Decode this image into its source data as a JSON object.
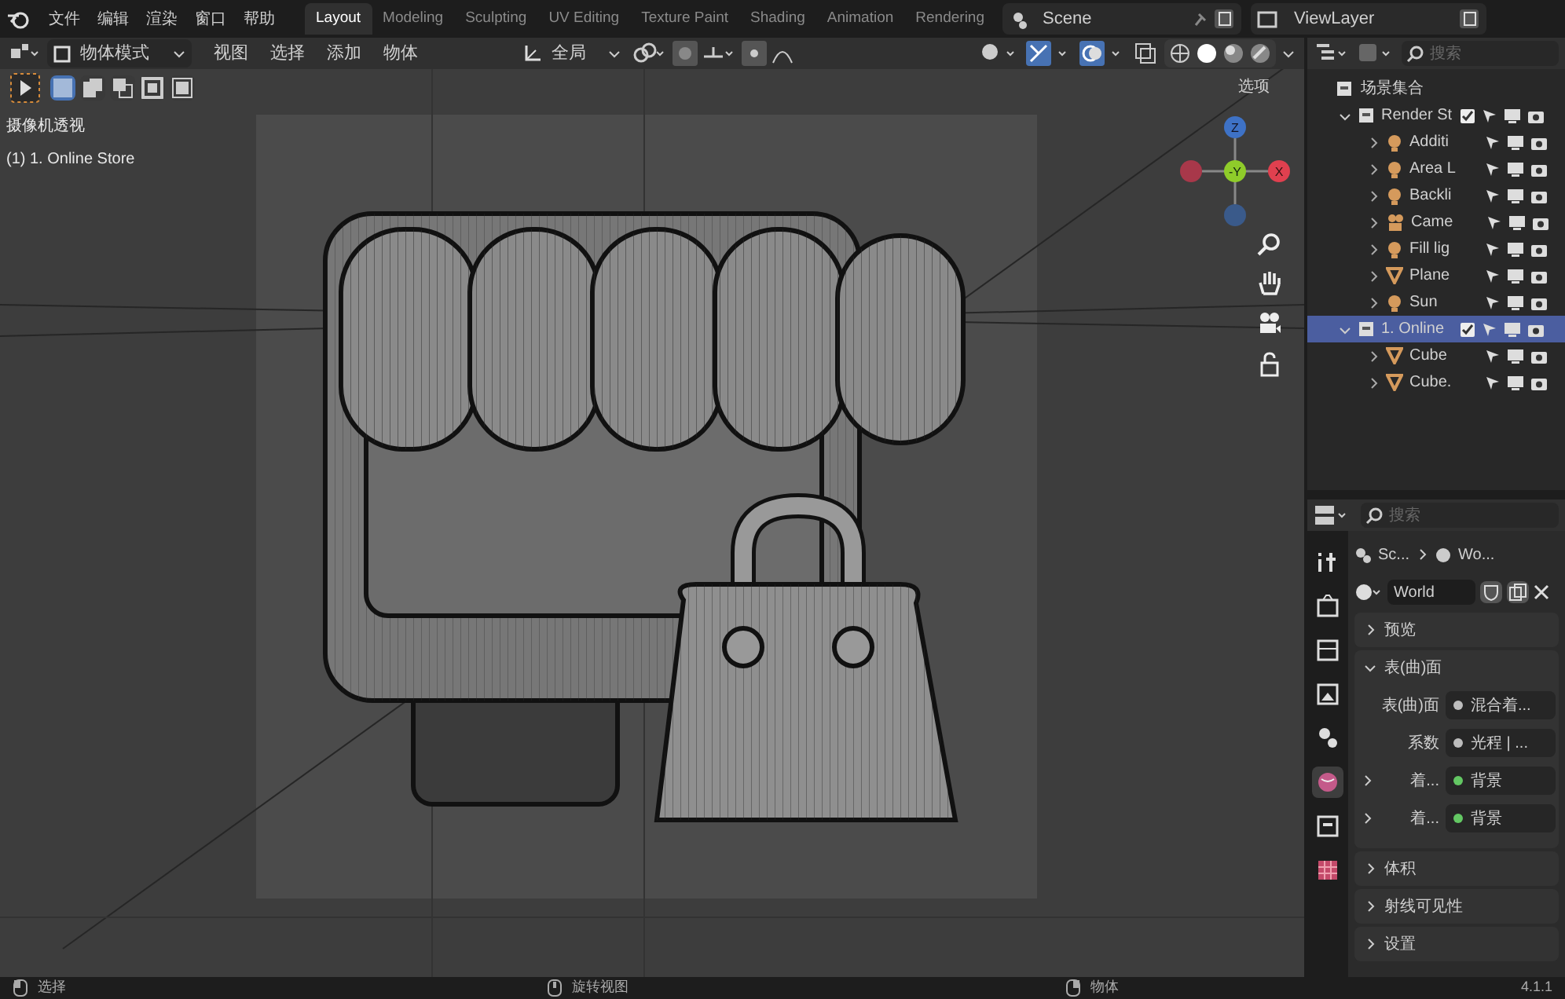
{
  "menu": [
    "文件",
    "编辑",
    "渲染",
    "窗口",
    "帮助"
  ],
  "workspaces": [
    {
      "label": "Layout",
      "selected": true
    },
    {
      "label": "Modeling",
      "selected": false
    },
    {
      "label": "Sculpting",
      "selected": false
    },
    {
      "label": "UV Editing",
      "selected": false
    },
    {
      "label": "Texture Paint",
      "selected": false
    },
    {
      "label": "Shading",
      "selected": false
    },
    {
      "label": "Animation",
      "selected": false
    },
    {
      "label": "Rendering",
      "selected": false
    }
  ],
  "scene": "Scene",
  "view_layer": "ViewLayer",
  "viewport_header": {
    "mode": "物体模式",
    "menus": [
      "视图",
      "选择",
      "添加",
      "物体"
    ],
    "orientation": "全局",
    "options": "选项"
  },
  "gizmo_axes": [
    "Z",
    "-Y",
    "X"
  ],
  "select_modes": [
    {
      "selected": true
    },
    {
      "selected": false
    },
    {
      "selected": false
    },
    {
      "selected": false
    },
    {
      "selected": false
    }
  ],
  "viewport_overlay": [
    "摄像机透视",
    "(1) 1. Online Store"
  ],
  "outliner": {
    "search_placeholder": "搜索",
    "root": "场景集合",
    "items": [
      {
        "label": "Render St",
        "kind": "collection",
        "expanded": true,
        "selected": false,
        "children": [
          {
            "label": "Additi",
            "kind": "light"
          },
          {
            "label": "Area L",
            "kind": "light"
          },
          {
            "label": "Backli",
            "kind": "light"
          },
          {
            "label": "Came",
            "kind": "camera"
          },
          {
            "label": "Fill lig",
            "kind": "light"
          },
          {
            "label": "Plane",
            "kind": "mesh"
          },
          {
            "label": "Sun",
            "kind": "light"
          }
        ]
      },
      {
        "label": "1. Online",
        "kind": "collection",
        "expanded": true,
        "selected": true,
        "children": [
          {
            "label": "Cube",
            "kind": "mesh"
          },
          {
            "label": "Cube.",
            "kind": "mesh"
          }
        ]
      }
    ]
  },
  "properties": {
    "search_placeholder": "搜索",
    "breadcrumb": [
      "Sc...",
      "Wo..."
    ],
    "world": "World",
    "tabs": [
      {
        "kind": "tool",
        "selected": false
      },
      {
        "kind": "render",
        "selected": false
      },
      {
        "kind": "output",
        "selected": false
      },
      {
        "kind": "view_layer",
        "selected": false
      },
      {
        "kind": "scene",
        "selected": false
      },
      {
        "kind": "world",
        "selected": true
      },
      {
        "kind": "collection",
        "selected": false
      },
      {
        "kind": "texture",
        "selected": false
      }
    ],
    "panels": [
      {
        "title": "预览",
        "expanded": false
      },
      {
        "title": "表(曲)面",
        "expanded": true,
        "rows": [
          {
            "label": "表(曲)面",
            "value": "混合着...",
            "color": "#bdbdbd",
            "expandable": false
          },
          {
            "label": "系数",
            "value": "光程 | ...",
            "color": "#bdbdbd",
            "expandable": false
          },
          {
            "label": "着...",
            "value": "背景",
            "color": "#63c763",
            "expandable": true
          },
          {
            "label": "着...",
            "value": "背景",
            "color": "#63c763",
            "expandable": true
          }
        ]
      },
      {
        "title": "体积",
        "expanded": false
      },
      {
        "title": "射线可见性",
        "expanded": false
      },
      {
        "title": "设置",
        "expanded": false
      }
    ]
  },
  "status_bar": {
    "hints": [
      "选择",
      "旋转视图",
      "物体"
    ],
    "version": "4.1.1"
  }
}
